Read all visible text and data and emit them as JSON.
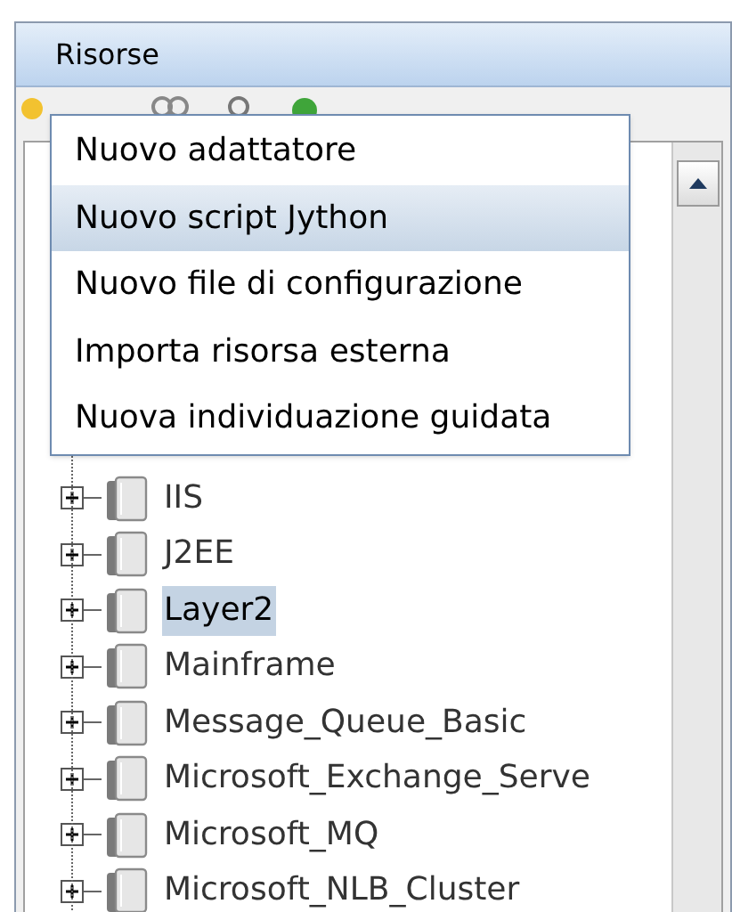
{
  "panel": {
    "title": "Risorse"
  },
  "context_menu": {
    "items": [
      {
        "label": "Nuovo adattatore",
        "selected": false
      },
      {
        "label": "Nuovo script Jython",
        "selected": true
      },
      {
        "label": "Nuovo file di configurazione",
        "selected": false
      },
      {
        "label": "Importa risorsa esterna",
        "selected": false
      },
      {
        "label": "Nuova individuazione guidata",
        "selected": false
      }
    ]
  },
  "tree": {
    "items": [
      {
        "label": "IIS",
        "expanded": false,
        "selected": false
      },
      {
        "label": "J2EE",
        "expanded": false,
        "selected": false
      },
      {
        "label": "Layer2",
        "expanded": false,
        "selected": true
      },
      {
        "label": "Mainframe",
        "expanded": false,
        "selected": false
      },
      {
        "label": "Message_Queue_Basic",
        "expanded": false,
        "selected": false
      },
      {
        "label": "Microsoft_Exchange_Serve",
        "expanded": false,
        "selected": false
      },
      {
        "label": "Microsoft_MQ",
        "expanded": false,
        "selected": false
      },
      {
        "label": "Microsoft_NLB_Cluster",
        "expanded": false,
        "selected": false
      }
    ]
  }
}
